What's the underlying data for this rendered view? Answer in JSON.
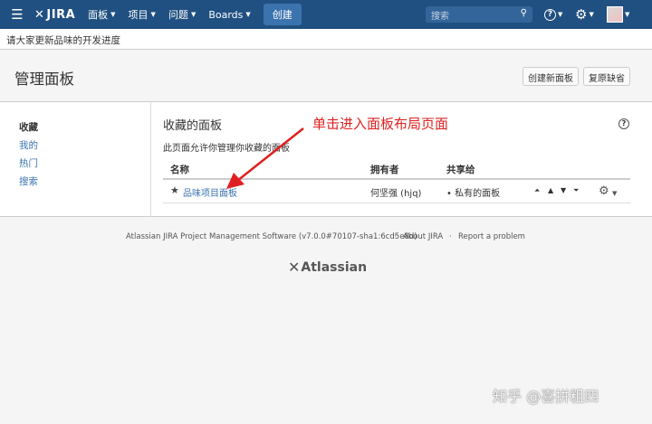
{
  "topnav": {
    "logo": "JIRA",
    "items": [
      {
        "label": "面板"
      },
      {
        "label": "项目"
      },
      {
        "label": "问题"
      },
      {
        "label": "Boards"
      }
    ],
    "create_label": "创建",
    "search_placeholder": "搜索",
    "help_icon": "help-icon",
    "settings_icon": "gear-icon",
    "accent_color": "#205081"
  },
  "announcement": "请大家更新品味的开发进度",
  "page": {
    "title": "管理面板",
    "buttons": {
      "create_board": "创建新面板",
      "restore_default": "复原缺省"
    }
  },
  "sidebar": {
    "items": [
      {
        "label": "收藏",
        "active": true
      },
      {
        "label": "我的",
        "active": false
      },
      {
        "label": "热门",
        "active": false
      },
      {
        "label": "搜索",
        "active": false
      }
    ]
  },
  "main": {
    "title": "收藏的面板",
    "description": "此页面允许你管理你收藏的面板",
    "columns": {
      "name": "名称",
      "owner": "拥有者",
      "shared": "共享给"
    },
    "rows": [
      {
        "name": "品味项目面板",
        "owner": "何坚强 (hjq)",
        "shared": "• 私有的面板"
      }
    ]
  },
  "annotation": "单击进入面板布局页面",
  "footer": {
    "version": "Atlassian JIRA Project Management Software (v7.0.0#70107-sha1:6cd5e8d)",
    "sep": "·",
    "about": "About JIRA",
    "report": "Report a problem",
    "logo": "Atlassian"
  },
  "watermark": "知乎 @喜拼粗四"
}
